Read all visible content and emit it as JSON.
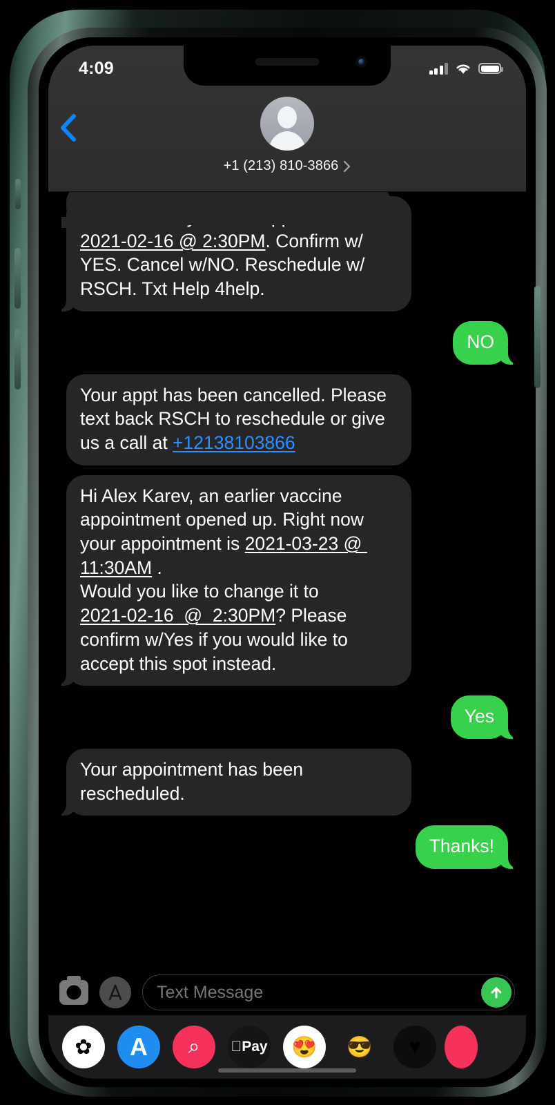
{
  "status_bar": {
    "time": "4:09",
    "signal_icon": "cellular-bars-icon",
    "wifi_icon": "wifi-icon",
    "battery_icon": "battery-full-icon"
  },
  "header": {
    "back_icon": "back-chevron-icon",
    "avatar_icon": "default-contact-avatar",
    "contact_name": "+1 (213) 810-3866",
    "detail_chevron": "chevron-right-icon"
  },
  "messages": [
    {
      "id": "msg-1",
      "direction": "incoming",
      "tail": true,
      "segments": [
        {
          "type": "text",
          "value": "Meredith Grey has an appt on\n"
        },
        {
          "type": "datalink",
          "value": "2021-02-16 @ 2:30PM"
        },
        {
          "type": "text",
          "value": ". Confirm w/ YES. Cancel w/NO. Reschedule w/ RSCH. Txt Help 4help."
        }
      ]
    },
    {
      "id": "msg-2",
      "direction": "outgoing",
      "tail": true,
      "segments": [
        {
          "type": "text",
          "value": "NO"
        }
      ]
    },
    {
      "id": "msg-3",
      "direction": "incoming",
      "tail": false,
      "segments": [
        {
          "type": "text",
          "value": "Your appt has been cancelled. Please text back RSCH to reschedule or give us a call at "
        },
        {
          "type": "tel",
          "value": "+12138103866"
        }
      ]
    },
    {
      "id": "msg-4",
      "direction": "incoming",
      "tail": true,
      "segments": [
        {
          "type": "text",
          "value": "Hi Alex Karev, an earlier vaccine appointment opened up. Right now your appointment is "
        },
        {
          "type": "datalink",
          "value": "2021-03-23 @ 11:30AM"
        },
        {
          "type": "text",
          "value": " .\nWould you like to change it to\n"
        },
        {
          "type": "datalink",
          "value": "2021-02-16  @  2:30PM"
        },
        {
          "type": "text",
          "value": "? Please confirm w/Yes if you would like to accept this spot instead."
        }
      ]
    },
    {
      "id": "msg-5",
      "direction": "outgoing",
      "tail": true,
      "segments": [
        {
          "type": "text",
          "value": "Yes"
        }
      ]
    },
    {
      "id": "msg-6",
      "direction": "incoming",
      "tail": true,
      "segments": [
        {
          "type": "text",
          "value": "Your appointment has been rescheduled."
        }
      ]
    },
    {
      "id": "msg-7",
      "direction": "outgoing",
      "tail": true,
      "segments": [
        {
          "type": "text",
          "value": "Thanks!"
        }
      ]
    }
  ],
  "input_bar": {
    "camera_icon": "camera-icon",
    "appstore_icon": "imessage-appstore-icon",
    "placeholder": "Text Message",
    "send_icon": "send-arrow-up-icon"
  },
  "app_drawer": {
    "apps": [
      {
        "name": "photos-app-icon",
        "glyph": "✿",
        "cls": "ai-photos"
      },
      {
        "name": "app-store-app-icon",
        "glyph": "A",
        "cls": "ai-appstore"
      },
      {
        "name": "images-search-app-icon",
        "glyph": "⌕",
        "cls": "ai-images"
      },
      {
        "name": "apple-pay-app-icon",
        "glyph": "Pay",
        "cls": "ai-pay"
      },
      {
        "name": "memoji-sticker-app-icon",
        "glyph": "😍",
        "cls": "ai-memoji-sticker"
      },
      {
        "name": "memoji-app-icon",
        "glyph": "😎",
        "cls": "ai-memoji"
      },
      {
        "name": "health-app-icon",
        "glyph": "♥",
        "cls": "ai-health"
      }
    ]
  },
  "colors": {
    "outgoing_bubble": "#38d14c",
    "incoming_bubble": "#262628",
    "link_blue": "#2b8fff",
    "accent_blue": "#0a84ff",
    "send_green": "#38c755"
  }
}
